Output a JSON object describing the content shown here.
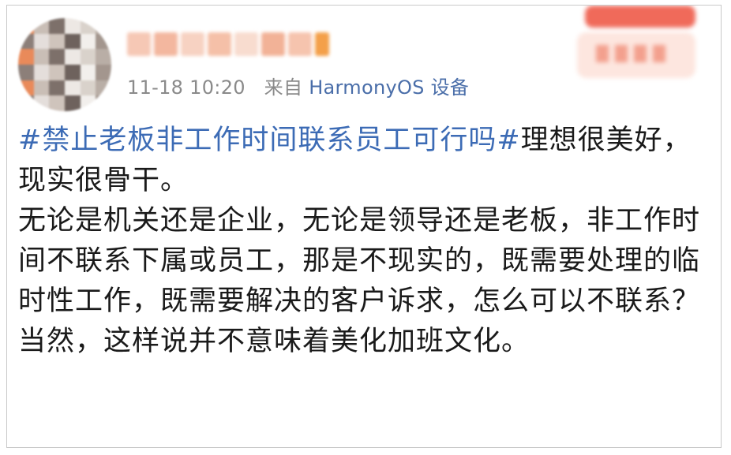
{
  "post": {
    "timestamp": "11-18 10:20",
    "source_prefix": "来自",
    "source_device": "HarmonyOS 设备",
    "hashtag": "#禁止老板非工作时间联系员工可行吗#",
    "line1_rest": "理想很美好，现实很骨干。",
    "paragraph2": "无论是机关还是企业，无论是领导还是老板，非工作时间不联系下属或员工，那是不现实的，既需要处理的临时性工作，既需要解决的客户诉求，怎么可以不联系？",
    "paragraph3": "当然，这样说并不意味着美化加班文化。"
  },
  "colors": {
    "hashtag": "#3c6bb5",
    "source_link": "#4a6ea9",
    "meta_gray": "#8a8a8a",
    "body_text": "#1a1a1a",
    "border": "#c9c9c9"
  },
  "icons": {
    "avatar": "user-avatar-blurred",
    "badge": "follow-badge-blurred"
  }
}
